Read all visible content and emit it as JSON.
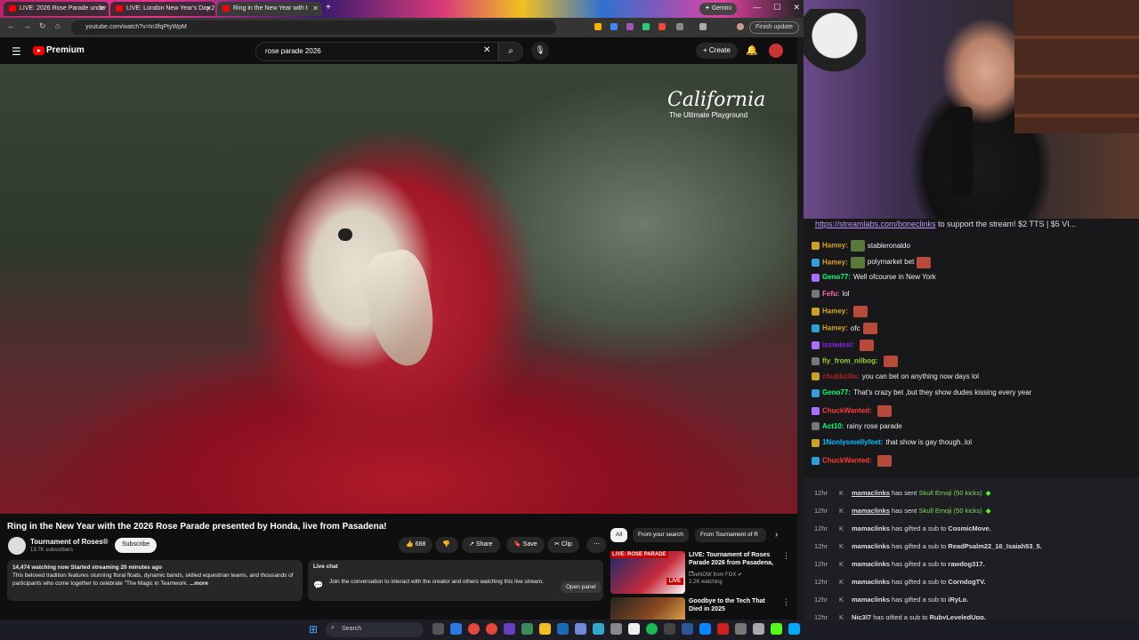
{
  "browser": {
    "tabs": [
      {
        "label": "LIVE: 2026 Rose Parade under"
      },
      {
        "label": "LIVE: London New Year's Day 2"
      },
      {
        "label": "Ring in the New Year with t"
      }
    ],
    "gemini_label": "Gemini",
    "url": "youtube.com/watch?v=In3fqPtyWpM",
    "finish_update": "Finish update"
  },
  "youtube": {
    "brand": "Premium",
    "search_value": "rose parade 2026",
    "create_label": "Create",
    "video_overlay": {
      "logo": "California",
      "tagline": "The Ultimate Playground"
    },
    "title": "Ring in the New Year with the 2026 Rose Parade presented by Honda, live from Pasadena!",
    "channel": {
      "name": "Tournament of Roses®",
      "subscribers": "13.7K subscribers",
      "subscribe_label": "Subscribe"
    },
    "actions": {
      "likes": "688",
      "share": "Share",
      "save": "Save",
      "clip": "Clip"
    },
    "description": {
      "stats": "14,474 watching now  Started streaming 20 minutes ago",
      "text": "This beloved tradition features stunning floral floats, dynamic bands, skilled equestrian teams, and thousands of participants who come together to celebrate \"The Magic in Teamwork.",
      "more": "...more"
    },
    "live_chat": {
      "heading": "Live chat",
      "text": "Join the conversation to interact with the creator and others watching this live stream.",
      "open_panel": "Open panel"
    },
    "chips": [
      "All",
      "From your search",
      "From Tournament of R"
    ],
    "recommendations": [
      {
        "title": "LIVE: Tournament of Roses Parade 2026 from Pasadena, ...",
        "channel": "LiveNOW from FOX",
        "meta": "2.2K watching",
        "thumb_label": "LIVE: ROSE PARADE",
        "badge": "LIVE"
      },
      {
        "title": "Goodbye to the Tech That Died in 2025",
        "channel": "",
        "meta": "",
        "thumb_label": "",
        "badge": ""
      }
    ]
  },
  "taskbar": {
    "search_placeholder": "Search"
  },
  "stream": {
    "link_text": "https://streamlabs.com/boneclinks",
    "link_suffix": " to support the stream! $2 TTS | $5 VI..."
  },
  "chat": [
    {
      "user": "Hamey:",
      "color": "#daa520",
      "text": "stableronaldo",
      "emote_before": true
    },
    {
      "user": "Hamey:",
      "color": "#daa520",
      "text": "polymarket bet",
      "emote_before": true,
      "emote_after": true
    },
    {
      "user": "Geno77:",
      "color": "#00ff7f",
      "text": "Well ofcourse in New York"
    },
    {
      "user": "Fefu:",
      "color": "#ff69b4",
      "text": "lol"
    },
    {
      "user": "Hamey:",
      "color": "#daa520",
      "text": "",
      "emote_after": true
    },
    {
      "user": "Hamey:",
      "color": "#daa520",
      "text": "ofc",
      "emote_after": true
    },
    {
      "user": "issiwissi:",
      "color": "#8a2be2",
      "text": "",
      "emote_after": true
    },
    {
      "user": "fly_from_nilbog:",
      "color": "#9acd32",
      "text": "",
      "emote_after": true
    },
    {
      "user": "chubbzilla:",
      "color": "#b22222",
      "text": "you can bet on anything now days lol"
    },
    {
      "user": "Geno77:",
      "color": "#00ff7f",
      "text": "That's crazy bet ,but they show dudes kissing every year"
    },
    {
      "user": "ChuckWanted:",
      "color": "#ff3b3b",
      "text": "",
      "emote_after": true
    },
    {
      "user": "Act10:",
      "color": "#00ff7f",
      "text": "rainy rose parade"
    },
    {
      "user": "1Nonlysmellyfeet:",
      "color": "#00bfff",
      "text": "that show is gay though..lol"
    },
    {
      "user": "ChuckWanted:",
      "color": "#ff3b3b",
      "text": "",
      "emote_after": true
    }
  ],
  "events": [
    {
      "time": "12hr",
      "user": "mamaclinks",
      "action": " has sent ",
      "target": "Skull Emoji (50 kicks)",
      "kind": "kicks"
    },
    {
      "time": "12hr",
      "user": "mamaclinks",
      "action": " has sent ",
      "target": "Skull Emoji (50 kicks)",
      "kind": "kicks"
    },
    {
      "time": "12hr",
      "user": "mamaclinks",
      "action": " has gifted a sub to ",
      "target": "CosmicMove.",
      "kind": "sub"
    },
    {
      "time": "12hr",
      "user": "mamaclinks",
      "action": " has gifted a sub to ",
      "target": "ReadPsalm22_16_Isaiah53_5.",
      "kind": "sub"
    },
    {
      "time": "12hr",
      "user": "mamaclinks",
      "action": " has gifted a sub to ",
      "target": "rawdog317.",
      "kind": "sub"
    },
    {
      "time": "12hr",
      "user": "mamaclinks",
      "action": " has gifted a sub to ",
      "target": "CorndogTV.",
      "kind": "sub"
    },
    {
      "time": "12hr",
      "user": "mamaclinks",
      "action": " has gifted a sub to ",
      "target": "iRyLo.",
      "kind": "sub"
    },
    {
      "time": "12hr",
      "user": "Nic3l7",
      "action": " has gifted a sub to ",
      "target": "RubyLeveledUpp.",
      "kind": "sub"
    }
  ]
}
